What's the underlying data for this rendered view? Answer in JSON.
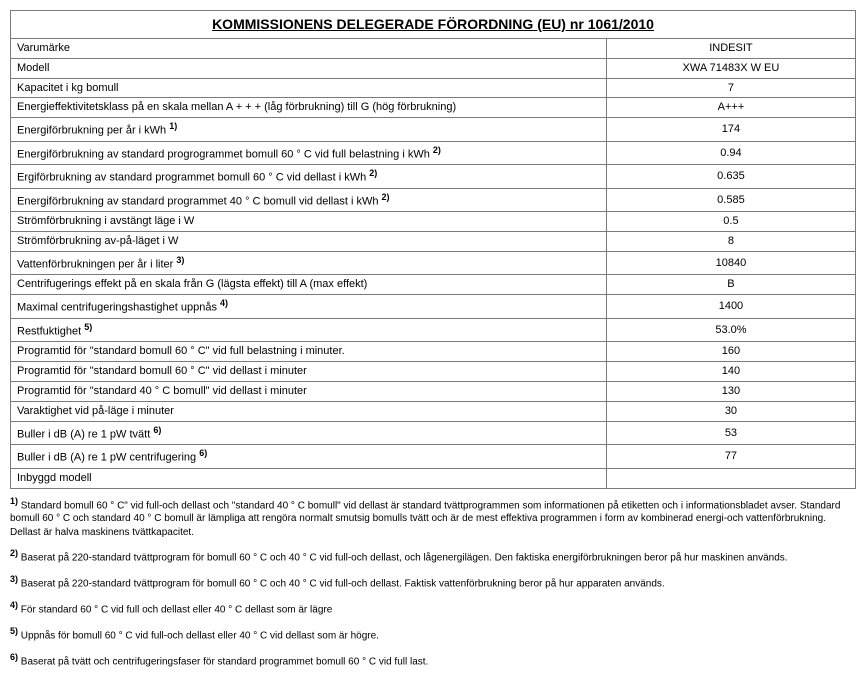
{
  "title": "KOMMISSIONENS DELEGERADE FÖRORDNING (EU) nr 1061/2010",
  "rows": [
    {
      "label": "Varumärke",
      "ref": "",
      "value": "INDESIT"
    },
    {
      "label": "Modell",
      "ref": "",
      "value": "XWA 71483X W EU"
    },
    {
      "label": "Kapacitet i kg bomull",
      "ref": "",
      "value": "7"
    },
    {
      "label": "Energieffektivitetsklass på en skala mellan A + + + (låg förbrukning) till G (hög förbrukning)",
      "ref": "",
      "value": "A+++"
    },
    {
      "label": "Energiförbrukning per år i kWh ",
      "ref": "1)",
      "value": "174"
    },
    {
      "label": "Energiförbrukning av standard progrogrammet bomull 60 ° C vid full belastning i kWh ",
      "ref": "2)",
      "value": "0.94"
    },
    {
      "label": "Ergiförbrukning av standard programmet bomull 60 ° C vid dellast i kWh ",
      "ref": "2)",
      "value": "0.635"
    },
    {
      "label": "Energiförbrukning av standard programmet 40 ° C bomull vid dellast i kWh ",
      "ref": "2)",
      "value": "0.585"
    },
    {
      "label": "Strömförbrukning i avstängt läge i W",
      "ref": "",
      "value": "0.5"
    },
    {
      "label": "Strömförbrukning av-på-läget i W",
      "ref": "",
      "value": "8"
    },
    {
      "label": "Vattenförbrukningen per år i liter ",
      "ref": "3)",
      "value": "10840"
    },
    {
      "label": "Centrifugerings effekt på en skala från G (lägsta effekt) till A (max effekt)",
      "ref": "",
      "value": "B"
    },
    {
      "label": "Maximal centrifugeringshastighet uppnås ",
      "ref": "4)",
      "value": "1400"
    },
    {
      "label": "Restfuktighet ",
      "ref": "5)",
      "value": "53.0%"
    },
    {
      "label": "Programtid för \"standard bomull 60 ° C\" vid full belastning i minuter.",
      "ref": "",
      "value": "160"
    },
    {
      "label": "Programtid för \"standard bomull 60 ° C\" vid dellast i minuter",
      "ref": "",
      "value": "140"
    },
    {
      "label": "Programtid för \"standard 40 ° C bomull\" vid dellast i minuter",
      "ref": "",
      "value": "130"
    },
    {
      "label": "Varaktighet vid på-läge i minuter",
      "ref": "",
      "value": "30"
    },
    {
      "label": "Buller i dB (A) re 1 pW tvätt ",
      "ref": "6)",
      "value": "53"
    },
    {
      "label": "Buller i dB (A) re 1 pW centrifugering ",
      "ref": "6)",
      "value": "77"
    },
    {
      "label": "Inbyggd modell",
      "ref": "",
      "value": ""
    }
  ],
  "footnotes": [
    {
      "ref": "1)",
      "text": "Standard bomull 60 ° C\" vid full-och dellast och \"standard 40 ° C bomull\" vid dellast är standard tvättprogrammen som informationen på etiketten och i informationsbladet avser. Standard bomull 60 ° C och standard 40 ° C bomull är lämpliga att rengöra normalt smutsig bomulls tvätt och är de mest effektiva programmen i form av kombinerad energi-och vattenförbrukning. Dellast är halva maskinens tvättkapacitet."
    },
    {
      "ref": "2)",
      "text": "Baserat på 220-standard tvättprogram för bomull 60 ° C och 40 ° C vid full-och dellast, och lågenergilägen. Den faktiska energiförbrukningen beror på hur maskinen används."
    },
    {
      "ref": "3)",
      "text": "Baserat på 220-standard tvättprogram för bomull 60 ° C och 40 ° C vid full-och dellast. Faktisk vattenförbrukning beror på hur apparaten används."
    },
    {
      "ref": "4)",
      "text": "För standard 60 ° C vid full och dellast eller 40 ° C dellast som är lägre"
    },
    {
      "ref": "5)",
      "text": "Uppnås för bomull 60 ° C vid full-och dellast eller 40 ° C vid dellast som är högre."
    },
    {
      "ref": "6)",
      "text": "Baserat på tvätt och centrifugeringsfaser för standard programmet bomull 60 ° C vid full last."
    }
  ]
}
